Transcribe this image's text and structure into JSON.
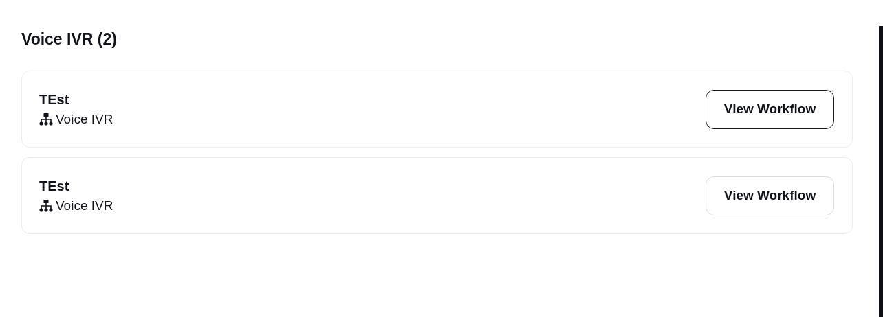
{
  "section": {
    "title": "Voice IVR (2)"
  },
  "workflows": [
    {
      "name": "TEst",
      "type": "Voice IVR",
      "button": {
        "label": "View Workflow",
        "focused": true
      }
    },
    {
      "name": "TEst",
      "type": "Voice IVR",
      "button": {
        "label": "View Workflow",
        "focused": false
      }
    }
  ]
}
